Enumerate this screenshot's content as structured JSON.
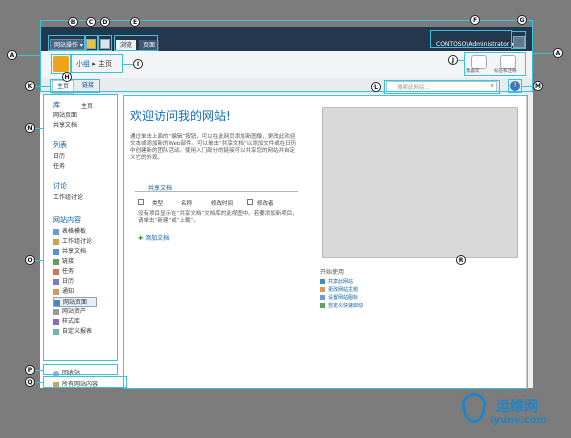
{
  "ribbon": {
    "site_actions": "网站操作",
    "tab_browse": "浏览",
    "tab_page": "页面",
    "user": "CONTOSO\\Administrator"
  },
  "header": {
    "breadcrumb": [
      "小组",
      "主页"
    ],
    "tags_label": "我喜欢",
    "notes_label": "标签和注释"
  },
  "topnav": {
    "tabs": [
      "主页",
      "链接"
    ],
    "search_placeholder": "搜索此网站..."
  },
  "sidebar": {
    "libraries_head": "库",
    "home_link": "主页",
    "libraries": [
      "网站页面",
      "共享文档"
    ],
    "lists_head": "列表",
    "lists": [
      "日历",
      "任务"
    ],
    "discussions_head": "讨论",
    "discussions": [
      "工作组讨论"
    ],
    "site_content_head": "网站内容",
    "site_content": [
      {
        "label": "表格模板",
        "icon": "template-icon"
      },
      {
        "label": "工作组讨论",
        "icon": "discussion-icon"
      },
      {
        "label": "共享文档",
        "icon": "document-library-icon"
      },
      {
        "label": "链接",
        "icon": "links-icon"
      },
      {
        "label": "任务",
        "icon": "tasks-icon"
      },
      {
        "label": "日历",
        "icon": "calendar-icon"
      },
      {
        "label": "通知",
        "icon": "announcement-icon"
      },
      {
        "label": "网站页面",
        "icon": "site-pages-icon"
      },
      {
        "label": "网站资产",
        "icon": "site-assets-icon"
      },
      {
        "label": "样式库",
        "icon": "style-library-icon"
      },
      {
        "label": "自定义报表",
        "icon": "report-icon"
      }
    ],
    "recycle_bin": "回收站",
    "all_content": "所有网站内容"
  },
  "main": {
    "welcome_title": "欢迎访问我的网站!",
    "intro": "通过单击上面的“编辑”按钮，可以在此网页添加新图像，更改此欢迎文本或添加新的Web部件。可以单击“共享文档”以添加文件或在日历中创建新的团队活动。使用入门部分的链接可以共享您的网站并自定义它的外观。",
    "shared_docs_head": "共享文档",
    "columns": [
      "类型",
      "名称",
      "修改时间",
      "修改者"
    ],
    "empty_text": "没有项目显示在“共享文档”文档库的此视图中。若要添加新项目，请单击“新建”或“上载”。",
    "add_doc": "添加文档",
    "getting_started_head": "开始使用",
    "getting_started": [
      {
        "label": "共享此网站",
        "icon": "share-icon"
      },
      {
        "label": "更改网站主题",
        "icon": "theme-icon"
      },
      {
        "label": "设置网站图标",
        "icon": "site-icon-icon"
      },
      {
        "label": "自定义快速启动",
        "icon": "quicklaunch-icon"
      }
    ]
  },
  "markers": [
    "A",
    "B",
    "C",
    "D",
    "E",
    "F",
    "G",
    "H",
    "I",
    "J",
    "K",
    "L",
    "M",
    "N",
    "O",
    "P",
    "Q",
    "R",
    "A"
  ],
  "watermark": {
    "main": "运维网",
    "sub": "iyunv.com"
  },
  "colors": {
    "ribbon": "#23384f",
    "link": "#0b5ea8",
    "title": "#0f6cbd",
    "callout": "#39c4de"
  }
}
